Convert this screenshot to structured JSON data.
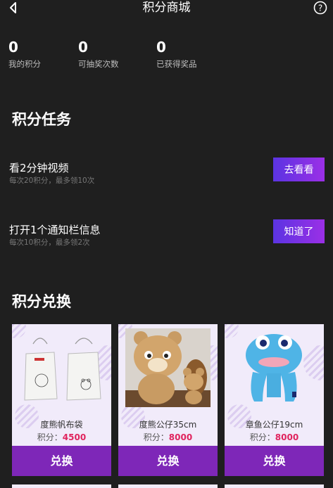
{
  "header": {
    "title": "积分商城",
    "back_icon": "back-arrow-icon",
    "help_icon": "help-icon"
  },
  "stats": [
    {
      "value": "0",
      "label": "我的积分"
    },
    {
      "value": "0",
      "label": "可抽奖次数"
    },
    {
      "value": "0",
      "label": "已获得奖品"
    }
  ],
  "tasks_section": {
    "title": "积分任务"
  },
  "tasks": [
    {
      "name": "看2分钟视频",
      "desc": "每次20积分，最多领10次",
      "button": "去看看"
    },
    {
      "name": "打开1个通知栏信息",
      "desc": "每次10积分，最多领2次",
      "button": "知道了"
    }
  ],
  "exchange_section": {
    "title": "积分兑换"
  },
  "products": [
    {
      "name": "度熊帆布袋",
      "points_label": "积分：",
      "points": "4500",
      "button": "兑换",
      "image": "canvas-bag"
    },
    {
      "name": "度熊公仔35cm",
      "points_label": "积分：",
      "points": "8000",
      "button": "兑换",
      "image": "bear-plush"
    },
    {
      "name": "章鱼公仔19cm",
      "points_label": "积分：",
      "points": "8000",
      "button": "兑换",
      "image": "octopus-plush"
    }
  ],
  "colors": {
    "background": "#1f1f1f",
    "accent": "#7e27b8",
    "points": "#e0245e"
  }
}
